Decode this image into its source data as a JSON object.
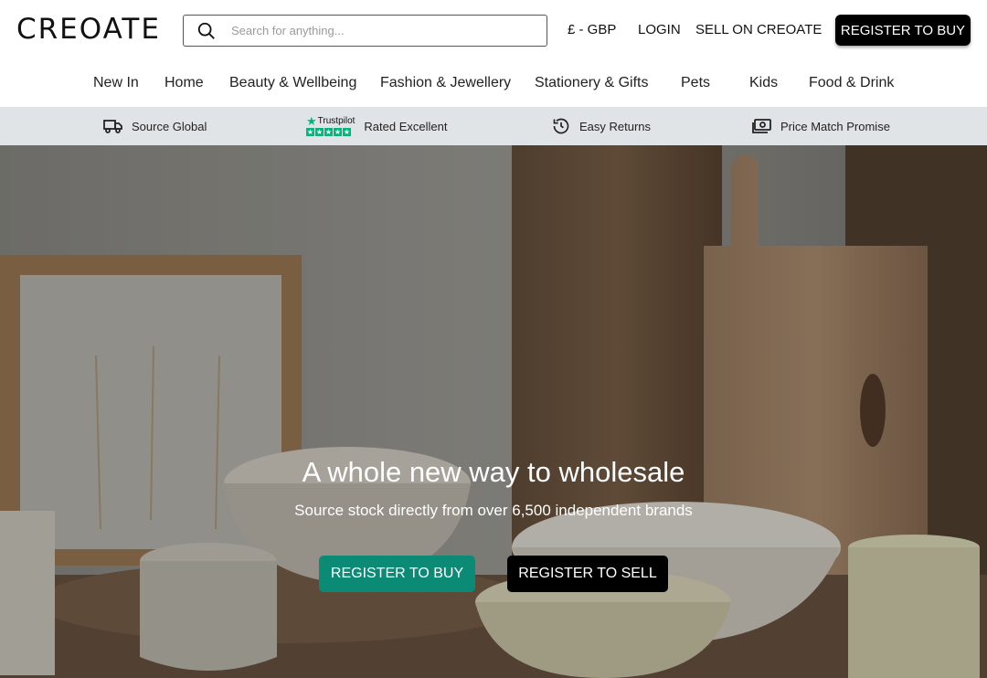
{
  "header": {
    "logo": "CREOATE",
    "search_placeholder": "Search for anything...",
    "currency": "£ - GBP",
    "login": "LOGIN",
    "sell": "SELL ON CREOATE",
    "register": "REGISTER TO BUY"
  },
  "categories": [
    "New In",
    "Home",
    "Beauty & Wellbeing",
    "Fashion & Jewellery",
    "Stationery & Gifts",
    "Pets",
    "Kids",
    "Food & Drink"
  ],
  "benefits": {
    "source": "Source Global",
    "trustpilot_brand": "Trustpilot",
    "rated": "Rated Excellent",
    "returns": "Easy Returns",
    "price": "Price Match Promise"
  },
  "hero": {
    "title": "A whole new way to wholesale",
    "subtitle": "Source stock directly from over 6,500 independent brands",
    "buy_button": "REGISTER TO BUY",
    "sell_button": "REGISTER TO SELL"
  },
  "icons": {
    "search": "search-icon",
    "truck": "truck-icon",
    "trustpilot": "trustpilot-logo",
    "returns": "history-icon",
    "price": "money-icon"
  },
  "colors": {
    "accent_teal": "#0b8a76",
    "strip_bg": "#e1e4e6",
    "trustpilot_green": "#00b67a"
  }
}
